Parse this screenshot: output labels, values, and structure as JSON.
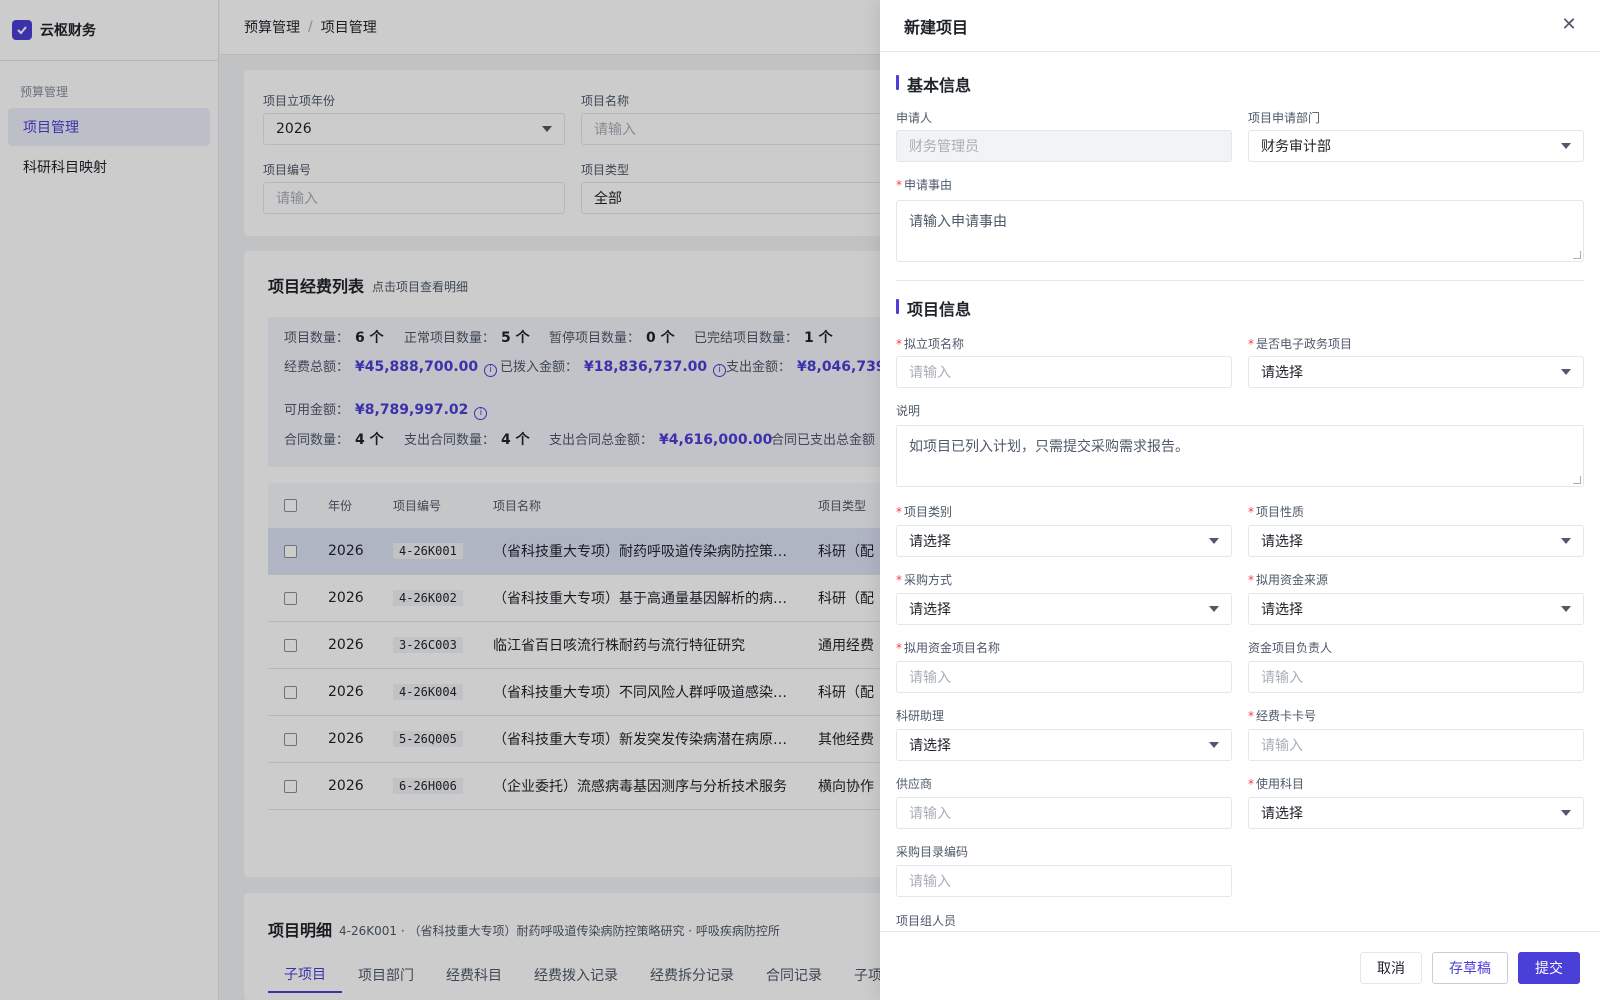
{
  "brand": {
    "name": "云枢财务"
  },
  "sidebar": {
    "group": "预算管理",
    "items": [
      {
        "label": "项目管理"
      },
      {
        "label": "科研科目映射"
      }
    ]
  },
  "breadcrumb": [
    "预算管理",
    "/",
    "项目管理"
  ],
  "filters": {
    "year_label": "项目立项年份",
    "year_value": "2026",
    "name_label": "项目名称",
    "name_placeholder": "请输入",
    "code_label": "项目编号",
    "code_placeholder": "请输入",
    "type_label": "项目类型",
    "type_value": "全部"
  },
  "list": {
    "title": "项目经费列表",
    "subtitle": "点击项目查看明细",
    "stats": {
      "count_label": "项目数量：",
      "count_value": "6 个",
      "normal_label": "正常项目数量：",
      "normal_value": "5 个",
      "paused_label": "暂停项目数量：",
      "paused_value": "0 个",
      "done_label": "已完结项目数量：",
      "done_value": "1 个",
      "total_label": "经费总额：",
      "total_value": "¥45,888,700.00",
      "allocated_label": "已拨入金额：",
      "allocated_value": "¥18,836,737.00",
      "expense_label": "支出金额：",
      "expense_value": "¥8,046,739",
      "available_label": "可用金额：",
      "available_value": "¥8,789,997.02",
      "contract_label": "合同数量：",
      "contract_value": "4 个",
      "exp_contract_label": "支出合同数量：",
      "exp_contract_value": "4 个",
      "exp_contract_total_label": "支出合同总金额：",
      "exp_contract_total_value": "¥4,616,000.00",
      "contract_paid_label": "合同已支出总金额"
    },
    "columns": {
      "year": "年份",
      "code": "项目编号",
      "name": "项目名称",
      "type": "项目类型"
    },
    "rows": [
      {
        "year": "2026",
        "code": "4-26K001",
        "name": "（省科技重大专项）耐药呼吸道传染病防控策…",
        "type": "科研（配"
      },
      {
        "year": "2026",
        "code": "4-26K002",
        "name": "（省科技重大专项）基于高通量基因解析的病…",
        "type": "科研（配"
      },
      {
        "year": "2026",
        "code": "3-26C003",
        "name": "临江省百日咳流行株耐药与流行特征研究",
        "type": "通用经费"
      },
      {
        "year": "2026",
        "code": "4-26K004",
        "name": "（省科技重大专项）不同风险人群呼吸道感染…",
        "type": "科研（配"
      },
      {
        "year": "2026",
        "code": "5-26Q005",
        "name": "（省科技重大专项）新发突发传染病潜在病原…",
        "type": "其他经费"
      },
      {
        "year": "2026",
        "code": "6-26H006",
        "name": "（企业委托）流感病毒基因测序与分析技术服务",
        "type": "横向协作"
      }
    ]
  },
  "detail": {
    "title": "项目明细",
    "subtitle": "4-26K001 · （省科技重大专项）耐药呼吸道传染病防控策略研究 · 呼吸疾病防控所",
    "tabs": [
      "子项目",
      "项目部门",
      "经费科目",
      "经费拨入记录",
      "经费拆分记录",
      "合同记录",
      "子项"
    ]
  },
  "drawer": {
    "title": "新建项目",
    "basic_title": "基本信息",
    "applicant_label": "申请人",
    "applicant_value": "财务管理员",
    "dept_label": "项目申请部门",
    "dept_value": "财务审计部",
    "reason_label": "申请事由",
    "reason_placeholder": "请输入申请事由",
    "project_title": "项目信息",
    "proj_name_label": "拟立项名称",
    "proj_name_placeholder": "请输入",
    "egov_label": "是否电子政务项目",
    "egov_value": "请选择",
    "desc_label": "说明",
    "desc_value": "如项目已列入计划，只需提交采购需求报告。",
    "category_label": "项目类别",
    "category_value": "请选择",
    "nature_label": "项目性质",
    "nature_value": "请选择",
    "purchase_label": "采购方式",
    "purchase_value": "请选择",
    "fund_source_label": "拟用资金来源",
    "fund_source_value": "请选择",
    "fund_name_label": "拟用资金项目名称",
    "fund_name_placeholder": "请输入",
    "fund_owner_label": "资金项目负责人",
    "fund_owner_placeholder": "请输入",
    "assistant_label": "科研助理",
    "assistant_value": "请选择",
    "card_label": "经费卡卡号",
    "card_placeholder": "请输入",
    "supplier_label": "供应商",
    "supplier_placeholder": "请输入",
    "subject_label": "使用科目",
    "subject_value": "请选择",
    "catalog_label": "采购目录编码",
    "catalog_placeholder": "请输入",
    "members_label": "项目组人员",
    "required_mark": "*",
    "cancel_label": "取消",
    "draft_label": "存草稿",
    "submit_label": "提交",
    "close_glyph": "✕"
  }
}
